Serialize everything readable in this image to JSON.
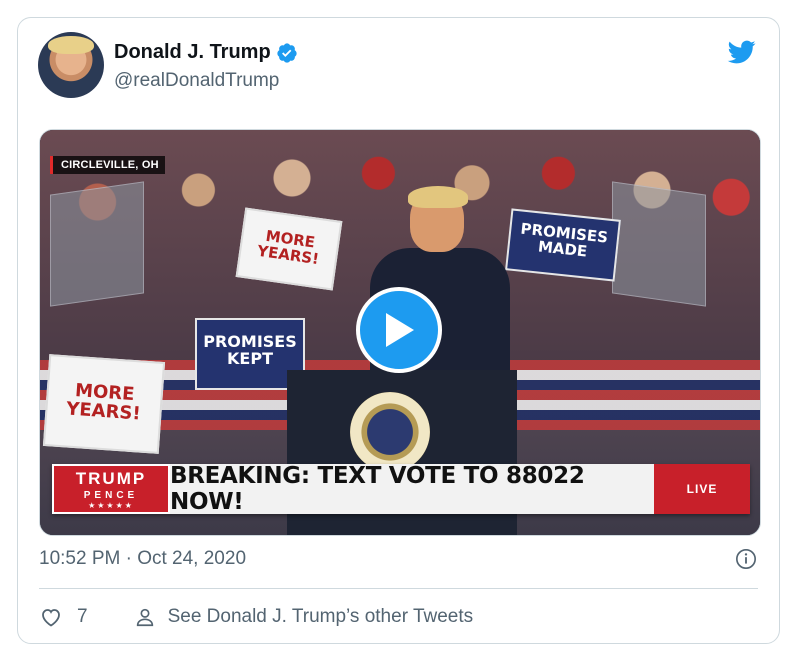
{
  "tweet": {
    "display_name": "Donald J. Trump",
    "handle": "@realDonaldTrump",
    "timestamp": "10:52 PM · Oct 24, 2020",
    "like_count": "7",
    "see_more_label": "See Donald J. Trump’s other Tweets"
  },
  "media": {
    "location_tag": "CIRCLEVILLE, OH",
    "lower_third": {
      "brand_line1": "TRUMP",
      "brand_line2": "PENCE",
      "brand_stars": "★★★★★",
      "headline": "BREAKING: TEXT VOTE TO 88022 NOW!",
      "live": "LIVE"
    },
    "signs": {
      "promises_kept": "PROMISES KEPT",
      "more_years_1": "MORE YEARS!",
      "more_years_2": "MORE YEARS!",
      "promises_made": "PROMISES MADE"
    }
  },
  "icons": {
    "verified": "verified-badge-icon",
    "twitter": "twitter-bird-icon",
    "play": "play-icon",
    "info": "info-icon",
    "like": "heart-icon",
    "user": "person-icon"
  },
  "colors": {
    "accent": "#1d9bf0",
    "text_primary": "#0f1419",
    "text_secondary": "#536471",
    "border": "#cfd9de",
    "live_red": "#c8202a"
  }
}
